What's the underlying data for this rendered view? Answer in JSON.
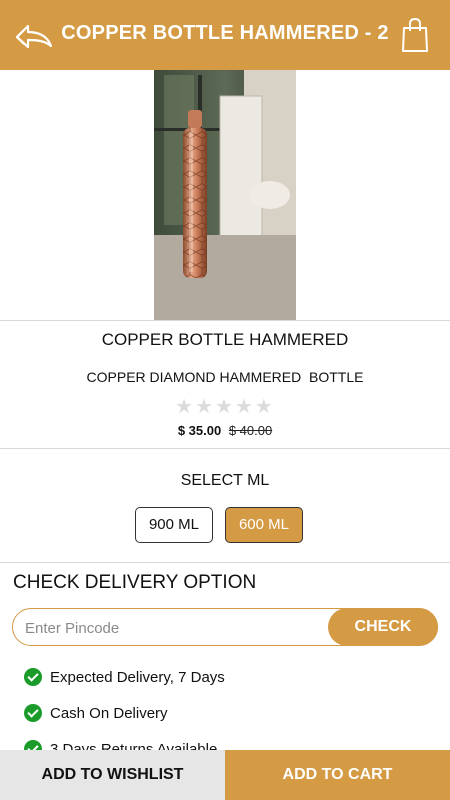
{
  "header": {
    "title": "COPPER BOTTLE HAMMERED - 2",
    "back_icon": "back-arrow-icon",
    "bag_icon": "shopping-bag-icon",
    "color": "#d49a44"
  },
  "product": {
    "image_icon": "product-photo",
    "name": "COPPER BOTTLE HAMMERED",
    "subtitle": "COPPER DIAMOND HAMMERED  BOTTLE",
    "rating": 0,
    "rating_max": 5,
    "stars": "★★★★★",
    "price_now": "$ 35.00",
    "price_old": "$ 40.00"
  },
  "size": {
    "label": "SELECT ML",
    "options": [
      "900 ML",
      "600 ML"
    ],
    "selected": "600 ML"
  },
  "delivery": {
    "heading": "CHECK DELIVERY OPTION",
    "pincode_placeholder": "Enter Pincode",
    "check_label": "CHECK",
    "features": [
      "Expected Delivery, 7 Days",
      "Cash On Delivery",
      "3 Days Returns Available"
    ]
  },
  "actions": {
    "wishlist": "ADD TO WISHLIST",
    "cart": "ADD TO CART"
  }
}
